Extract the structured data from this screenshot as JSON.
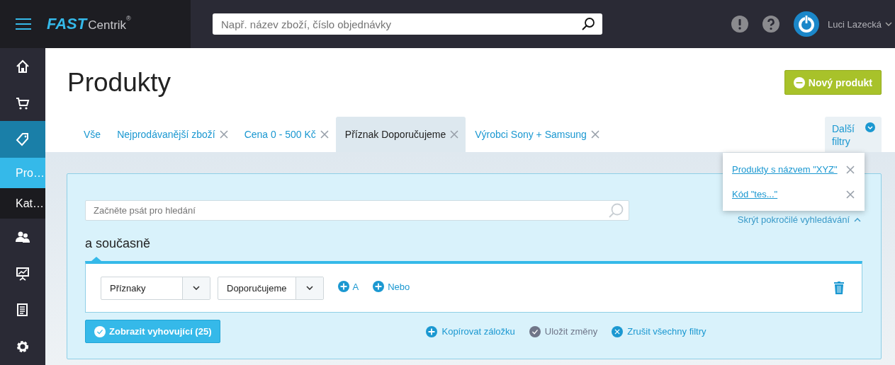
{
  "topbar": {
    "brand": {
      "main": "FAST",
      "sub": "Centrik",
      "mark": "®"
    },
    "search": {
      "placeholder": "Např. název zboží, číslo objednávky"
    },
    "user": {
      "name": "Luci Lazecká"
    }
  },
  "sidebar": {
    "items": [
      {
        "kind": "icon",
        "selected": false
      },
      {
        "kind": "icon",
        "selected": false
      },
      {
        "kind": "icon",
        "selected": true
      },
      {
        "kind": "link",
        "label": "Pro…",
        "selected": true
      },
      {
        "kind": "link",
        "label": "Kat…",
        "selected": false
      },
      {
        "kind": "icon",
        "selected": false
      },
      {
        "kind": "icon",
        "selected": false
      },
      {
        "kind": "icon",
        "selected": false
      },
      {
        "kind": "icon",
        "selected": false
      }
    ]
  },
  "page": {
    "title": "Produkty",
    "new_button": "Nový produkt"
  },
  "tabs": [
    {
      "label": "Vše",
      "selected": false,
      "closable": false
    },
    {
      "label": "Nejprodávanější zboží",
      "selected": false,
      "closable": true
    },
    {
      "label": "Cena 0 - 500 Kč",
      "selected": false,
      "closable": true
    },
    {
      "label": "Příznak Doporučujeme",
      "selected": true,
      "closable": true
    },
    {
      "label": "Výrobci Sony + Samsung",
      "selected": false,
      "closable": true
    }
  ],
  "more_filters": {
    "label": "Další filtry",
    "expanded": true,
    "items": [
      {
        "label": "Produkty s názvem \"XYZ\""
      },
      {
        "label": "Kód \"tes...\""
      }
    ]
  },
  "filter_panel": {
    "search": {
      "placeholder": "Začněte psát pro hledání"
    },
    "hide_link": "Skrýt pokročilé vyhledávání",
    "section_title": "a současně",
    "selects": [
      {
        "value": "Příznaky"
      },
      {
        "value": "Doporučujeme"
      }
    ],
    "add_buttons": [
      "A",
      "Nebo"
    ],
    "submit": "Zobrazit vyhovující (25)",
    "actions": [
      {
        "kind": "add",
        "label": "Kopírovat záložku"
      },
      {
        "kind": "save",
        "label": "Uložit změny"
      },
      {
        "kind": "cancel",
        "label": "Zrušit všechny filtry"
      }
    ]
  }
}
